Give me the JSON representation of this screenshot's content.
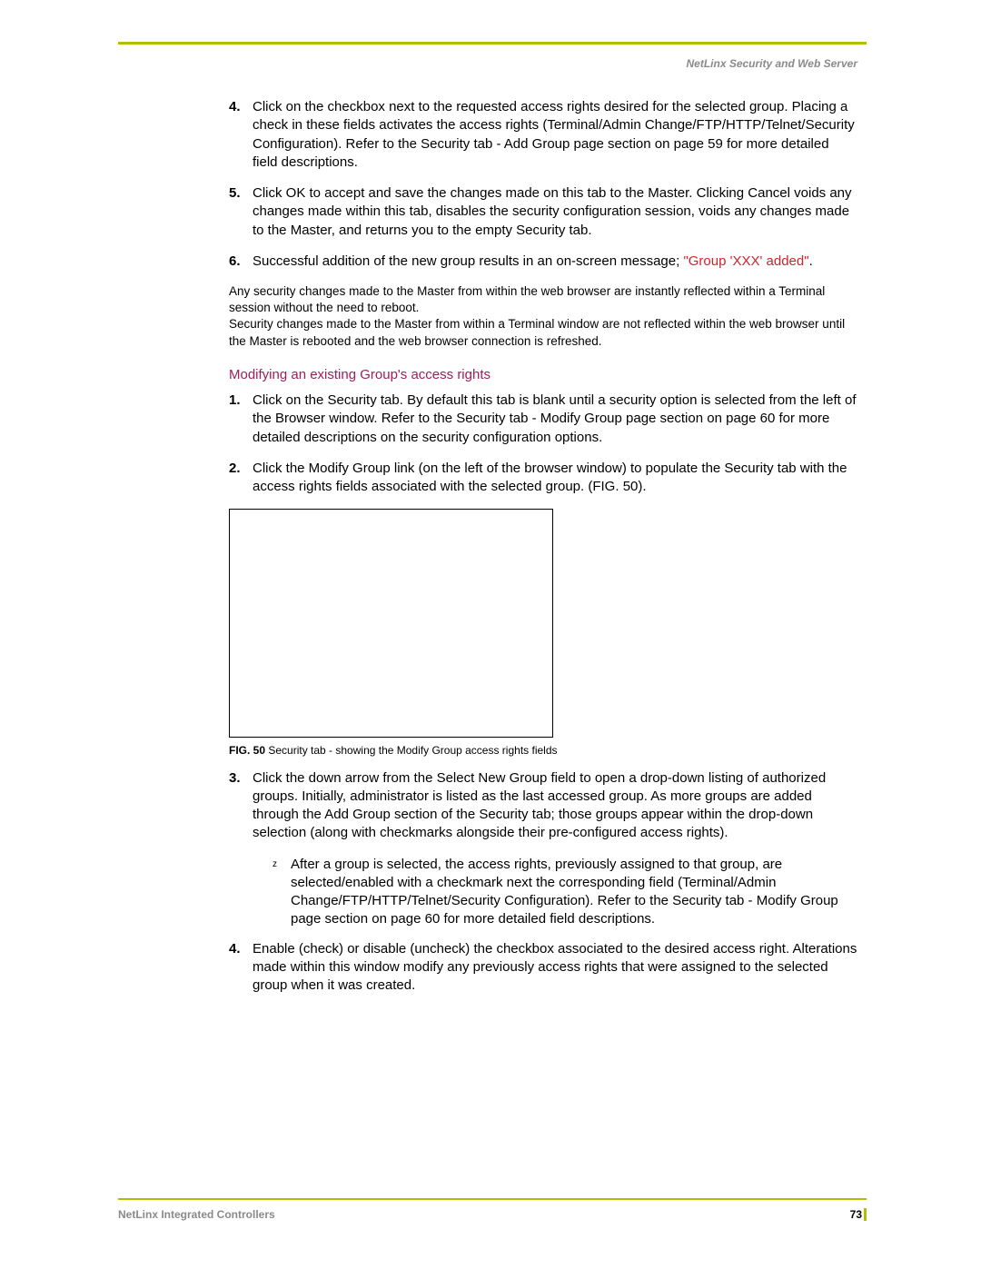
{
  "header": {
    "sectionTitle": "NetLinx Security and Web Server"
  },
  "stepsA": [
    {
      "num": "4.",
      "text": "Click on the checkbox next to the requested access rights desired for the selected group. Placing a check in these fields activates the access rights (Terminal/Admin Change/FTP/HTTP/Telnet/Security Configuration). Refer to the Security tab - Add Group page section on page 59 for more detailed field descriptions."
    },
    {
      "num": "5.",
      "text": "Click OK to accept and save the changes made on this tab to the Master. Clicking Cancel voids any changes made within this tab, disables the security configuration session, voids any changes made to the Master, and returns you to the empty Security tab."
    },
    {
      "num": "6.",
      "textPrefix": "Successful addition of the new group results in an on-screen message; ",
      "highlight": "\"Group 'XXX' added\"",
      "textSuffix": "."
    }
  ],
  "note": "Any security changes made to the Master from within the web browser are instantly reflected within a Terminal session without the need to reboot.\nSecurity changes made to the Master from within a Terminal window are not reflected within the web browser until the Master is rebooted and the web browser connection is refreshed.",
  "sectionHeading": "Modifying an existing Group's access rights",
  "stepsB_first": [
    {
      "num": "1.",
      "text": "Click on the Security tab. By default this tab is blank until a security option is selected from the left of the Browser window. Refer to the Security tab - Modify Group page section on page 60 for more detailed descriptions on the security configuration options."
    },
    {
      "num": "2.",
      "text": "Click the Modify Group link (on the left of the browser window) to populate the Security tab with the access rights fields associated with the selected group. (FIG. 50)."
    }
  ],
  "figure": {
    "label": "FIG. 50",
    "caption": "Security tab - showing the Modify Group access rights fields"
  },
  "stepsB_after": [
    {
      "num": "3.",
      "text": "Click the down arrow from the Select New Group field to open a drop-down listing of authorized groups. Initially, administrator is listed as the last accessed group. As more groups are added through the Add Group section of the Security tab; those groups appear within the drop-down selection (along with checkmarks alongside their pre-configured access rights)."
    }
  ],
  "subBullet": "After a group is selected, the access rights, previously assigned to that group, are selected/enabled with a checkmark next the corresponding field (Terminal/Admin Change/FTP/HTTP/Telnet/Security Configuration). Refer to the Security tab - Modify Group page section on page 60 for more detailed field descriptions.",
  "stepsB_last": [
    {
      "num": "4.",
      "text": "Enable (check) or disable (uncheck) the checkbox associated to the desired access right. Alterations made within this window modify any previously access rights that were assigned to the selected group when it was created."
    }
  ],
  "footer": {
    "title": "NetLinx Integrated Controllers",
    "pageNumber": "73"
  }
}
